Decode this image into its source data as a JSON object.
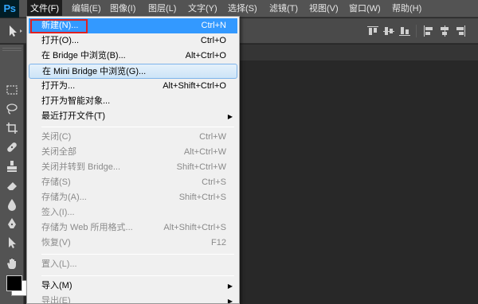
{
  "app": {
    "logo": "Ps"
  },
  "menubar": {
    "items": [
      {
        "label": "文件(F)",
        "active": true
      },
      {
        "label": "编辑(E)"
      },
      {
        "label": "图像(I)"
      },
      {
        "label": "图层(L)"
      },
      {
        "label": "文字(Y)"
      },
      {
        "label": "选择(S)"
      },
      {
        "label": "滤镜(T)"
      },
      {
        "label": "视图(V)"
      },
      {
        "label": "窗口(W)"
      },
      {
        "label": "帮助(H)"
      }
    ]
  },
  "file_menu": {
    "items": [
      {
        "label": "新建(N)...",
        "shortcut": "Ctrl+N",
        "state": "selected"
      },
      {
        "label": "打开(O)...",
        "shortcut": "Ctrl+O"
      },
      {
        "label": "在 Bridge 中浏览(B)...",
        "shortcut": "Alt+Ctrl+O"
      },
      {
        "label": "在 Mini Bridge 中浏览(G)...",
        "shortcut": "",
        "state": "hover"
      },
      {
        "label": "打开为...",
        "shortcut": "Alt+Shift+Ctrl+O"
      },
      {
        "label": "打开为智能对象...",
        "shortcut": ""
      },
      {
        "label": "最近打开文件(T)",
        "shortcut": "",
        "submenu": true
      },
      {
        "label": "关闭(C)",
        "shortcut": "Ctrl+W",
        "disabled": true
      },
      {
        "label": "关闭全部",
        "shortcut": "Alt+Ctrl+W",
        "disabled": true
      },
      {
        "label": "关闭并转到 Bridge...",
        "shortcut": "Shift+Ctrl+W",
        "disabled": true
      },
      {
        "label": "存储(S)",
        "shortcut": "Ctrl+S",
        "disabled": true
      },
      {
        "label": "存储为(A)...",
        "shortcut": "Shift+Ctrl+S",
        "disabled": true
      },
      {
        "label": "签入(I)...",
        "shortcut": "",
        "disabled": true
      },
      {
        "label": "存储为 Web 所用格式...",
        "shortcut": "Alt+Shift+Ctrl+S",
        "disabled": true
      },
      {
        "label": "恢复(V)",
        "shortcut": "F12",
        "disabled": true
      },
      {
        "label": "置入(L)...",
        "shortcut": "",
        "disabled": true
      },
      {
        "label": "导入(M)",
        "shortcut": "",
        "submenu": true
      },
      {
        "label": "导出(E)",
        "shortcut": "",
        "submenu": true,
        "disabled": true
      }
    ]
  },
  "toolbar": {
    "tools": [
      "marquee-icon",
      "lasso-icon",
      "crop-icon",
      "healing-brush-icon",
      "clone-stamp-icon",
      "eraser-icon",
      "blur-icon",
      "pen-icon",
      "path-selection-icon",
      "hand-icon"
    ],
    "foreground_color": "#000000",
    "background_color": "#ffffff"
  },
  "colors": {
    "menubar": "#535353",
    "menu_selected": "#3399ff",
    "highlight_box": "#e02020"
  }
}
